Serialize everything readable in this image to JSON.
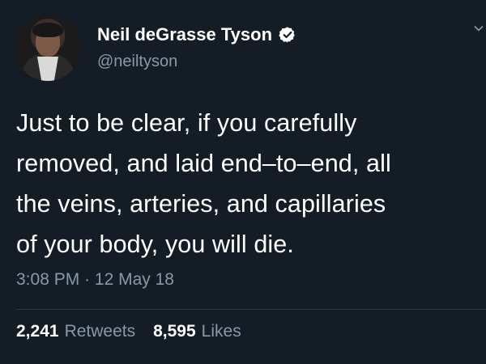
{
  "user": {
    "name": "Neil deGrasse Tyson",
    "handle": "@neiltyson",
    "verified": true
  },
  "tweet": {
    "text": "Just to be clear, if you carefully\nremoved, and laid end–to–end, all\nthe veins, arteries, and capillaries\nof your body, you will die.",
    "time": "3:08 PM",
    "separator": "·",
    "date": "12 May 18"
  },
  "stats": {
    "retweets_count": "2,241",
    "retweets_label": "Retweets",
    "likes_count": "8,595",
    "likes_label": "Likes"
  },
  "colors": {
    "background": "#141d26",
    "secondary_text": "#8899a6",
    "primary_text": "#ffffff"
  },
  "icons": {
    "verified": "verified-badge-icon",
    "more": "chevron-down-icon"
  }
}
